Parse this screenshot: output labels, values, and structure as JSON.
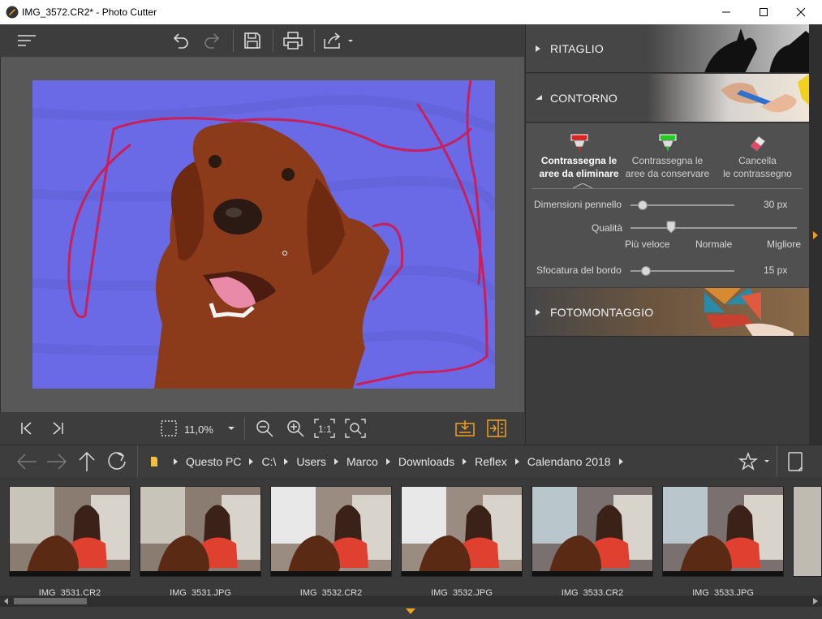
{
  "window": {
    "title": "IMG_3572.CR2* - Photo Cutter",
    "minimize_icon": "minimize-icon",
    "maximize_icon": "maximize-icon",
    "close_icon": "close-icon"
  },
  "toolbar": {
    "icons": [
      "menu-icon",
      "undo-icon",
      "redo-icon",
      "save-icon",
      "print-icon",
      "share-icon"
    ]
  },
  "panel": {
    "sections": {
      "crop": {
        "label": "RITAGLIO",
        "expanded": false
      },
      "contour": {
        "label": "CONTORNO",
        "expanded": true
      },
      "montage": {
        "label": "FOTOMONTAGGIO",
        "expanded": false
      }
    },
    "modes": [
      {
        "label1": "Contrassegna le",
        "label2": "aree da eliminare",
        "icon": "red-marker-icon",
        "active": true
      },
      {
        "label1": "Contrassegna le",
        "label2": "aree da conservare",
        "icon": "green-marker-icon",
        "active": false
      },
      {
        "label1": "Cancella",
        "label2": "le contrassegno",
        "icon": "eraser-icon",
        "active": false
      }
    ],
    "brush_size": {
      "label": "Dimensioni pennello",
      "value": "30 px",
      "level": 0.12
    },
    "quality": {
      "label": "Qualità",
      "ticks": [
        "Più veloce",
        "Normale",
        "Migliore"
      ],
      "level": 0.25
    },
    "edge_blur": {
      "label": "Sfocatura del bordo",
      "value": "15 px",
      "level": 0.15
    }
  },
  "viewbar": {
    "zoom": "11,0%",
    "icons": [
      "first-image-icon",
      "last-image-icon",
      "fit-screen-icon",
      "zoom-out-icon",
      "zoom-in-icon",
      "actual-size-icon",
      "zoom-fit-icon",
      "save-result-icon",
      "split-view-icon"
    ]
  },
  "nav": {
    "icons": [
      "back-arrow-icon",
      "forward-arrow-icon",
      "up-arrow-icon",
      "refresh-icon",
      "folder-icon",
      "favorite-star-icon",
      "tablet-icon"
    ],
    "breadcrumb": [
      "Questo PC",
      "C:\\",
      "Users",
      "Marco",
      "Downloads",
      "Reflex",
      "Calendano 2018"
    ]
  },
  "thumbnails": [
    {
      "name": "IMG_3531.CR2"
    },
    {
      "name": "IMG_3531.JPG"
    },
    {
      "name": "IMG_3532.CR2"
    },
    {
      "name": "IMG_3532.JPG"
    },
    {
      "name": "IMG_3533.CR2"
    },
    {
      "name": "IMG_3533.JPG"
    }
  ],
  "colors": {
    "accent": "#f0a020",
    "mask_blue": "#6a6ae6",
    "stroke_red": "#c8205a"
  }
}
